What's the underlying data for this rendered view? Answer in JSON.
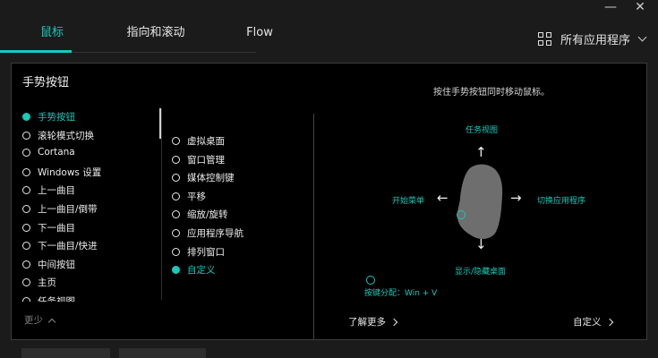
{
  "tabs": [
    {
      "label": "鼠标",
      "active": true
    },
    {
      "label": "指向和滚动",
      "active": false
    },
    {
      "label": "Flow",
      "active": false
    }
  ],
  "apps": {
    "label": "所有应用程序"
  },
  "panel": {
    "title": "手势按钮",
    "hint": "按住手势按钮同时移动鼠标。",
    "functions": [
      {
        "label": "手势按钮",
        "selected": true
      },
      {
        "label": "滚轮模式切换",
        "selected": false
      },
      {
        "label": "Cortana",
        "selected": false
      },
      {
        "label": "Windows 设置",
        "selected": false
      },
      {
        "label": "上一曲目",
        "selected": false
      },
      {
        "label": "上一曲目/倒带",
        "selected": false
      },
      {
        "label": "下一曲目",
        "selected": false
      },
      {
        "label": "下一曲目/快进",
        "selected": false
      },
      {
        "label": "中间按钮",
        "selected": false
      },
      {
        "label": "主页",
        "selected": false
      },
      {
        "label": "任务视图",
        "selected": false
      }
    ],
    "more_label": "更少",
    "gesture_types": [
      {
        "label": "虚拟桌面",
        "selected": false
      },
      {
        "label": "窗口管理",
        "selected": false
      },
      {
        "label": "媒体控制键",
        "selected": false
      },
      {
        "label": "平移",
        "selected": false
      },
      {
        "label": "缩放/旋转",
        "selected": false
      },
      {
        "label": "应用程序导航",
        "selected": false
      },
      {
        "label": "排列窗口",
        "selected": false
      },
      {
        "label": "自定义",
        "selected": true
      }
    ],
    "diagram": {
      "up": "任务视图",
      "left": "开始菜单",
      "right": "切换应用程序",
      "down": "显示/隐藏桌面",
      "click": "按键分配：Win + V"
    },
    "learn_more": "了解更多",
    "customize": "自定义"
  },
  "colors": {
    "accent": "#19c9b9",
    "panel_bg": "#000000",
    "window_bg": "#1b1b1b"
  }
}
